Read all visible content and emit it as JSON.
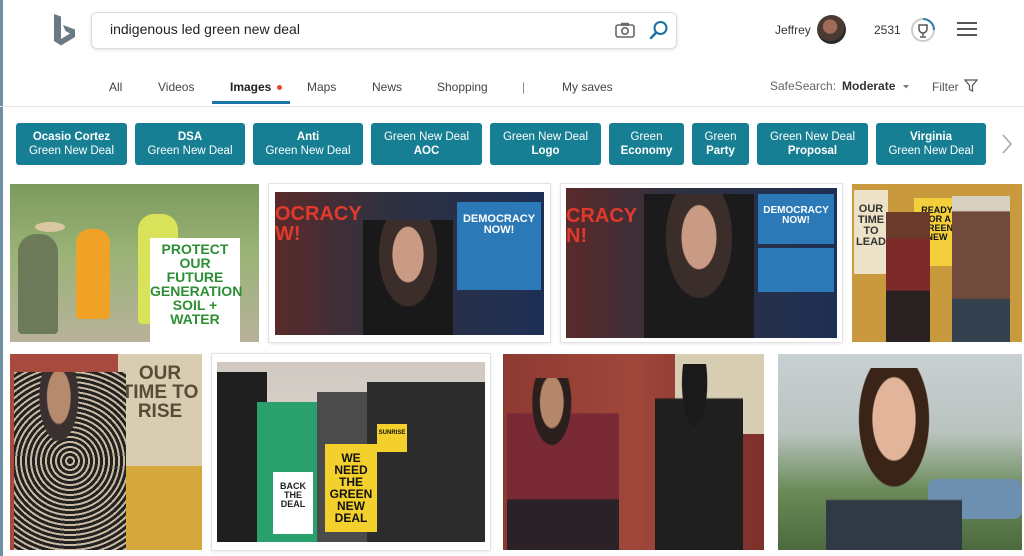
{
  "header": {
    "search_query": "indigenous led green new deal",
    "user_name": "Jeffrey",
    "reward_points": "2531"
  },
  "nav": {
    "tabs": [
      "All",
      "Videos",
      "Images",
      "Maps",
      "News",
      "Shopping",
      "|",
      "My saves"
    ],
    "active": "Images",
    "safesearch_label": "SafeSearch:",
    "safesearch_value": "Moderate",
    "filter_label": "Filter"
  },
  "chips": [
    {
      "line1": "Ocasio Cortez",
      "line2": "Green New Deal"
    },
    {
      "line1": "DSA",
      "line2": "Green New Deal"
    },
    {
      "line1": "Anti",
      "line2": "Green New Deal"
    },
    {
      "line1": "Green New Deal",
      "line2": "AOC"
    },
    {
      "line1": "Green New Deal",
      "line2": "Logo"
    },
    {
      "line1": "Green",
      "line2": "Economy"
    },
    {
      "line1": "Green",
      "line2": "Party"
    },
    {
      "line1": "Green New Deal",
      "line2": "Proposal"
    },
    {
      "line1": "Virginia",
      "line2": "Green New Deal"
    }
  ],
  "image_text": {
    "protest_sign": "PROTECT OUR FUTURE GENERATION SOIL + WATER",
    "dn_banner": "DEMOCRACY NOW!",
    "dn_left": "OCRACY W!",
    "dn_left2": "CRACY N!",
    "time_to_rise_1": "OUR TIME TO LEAD",
    "ready_sign": "READY FOR A GREEN NEW",
    "time_to_rise_2": "OUR TIME TO RISE",
    "back_the_deal": "BACK THE DEAL",
    "we_need_sign": "WE NEED THE GREEN NEW DEAL",
    "sunrise": "SUNRISE"
  },
  "colors": {
    "chip_bg": "#177f93",
    "active_underline": "#1a73a8",
    "notification_dot": "#e04a2f"
  }
}
